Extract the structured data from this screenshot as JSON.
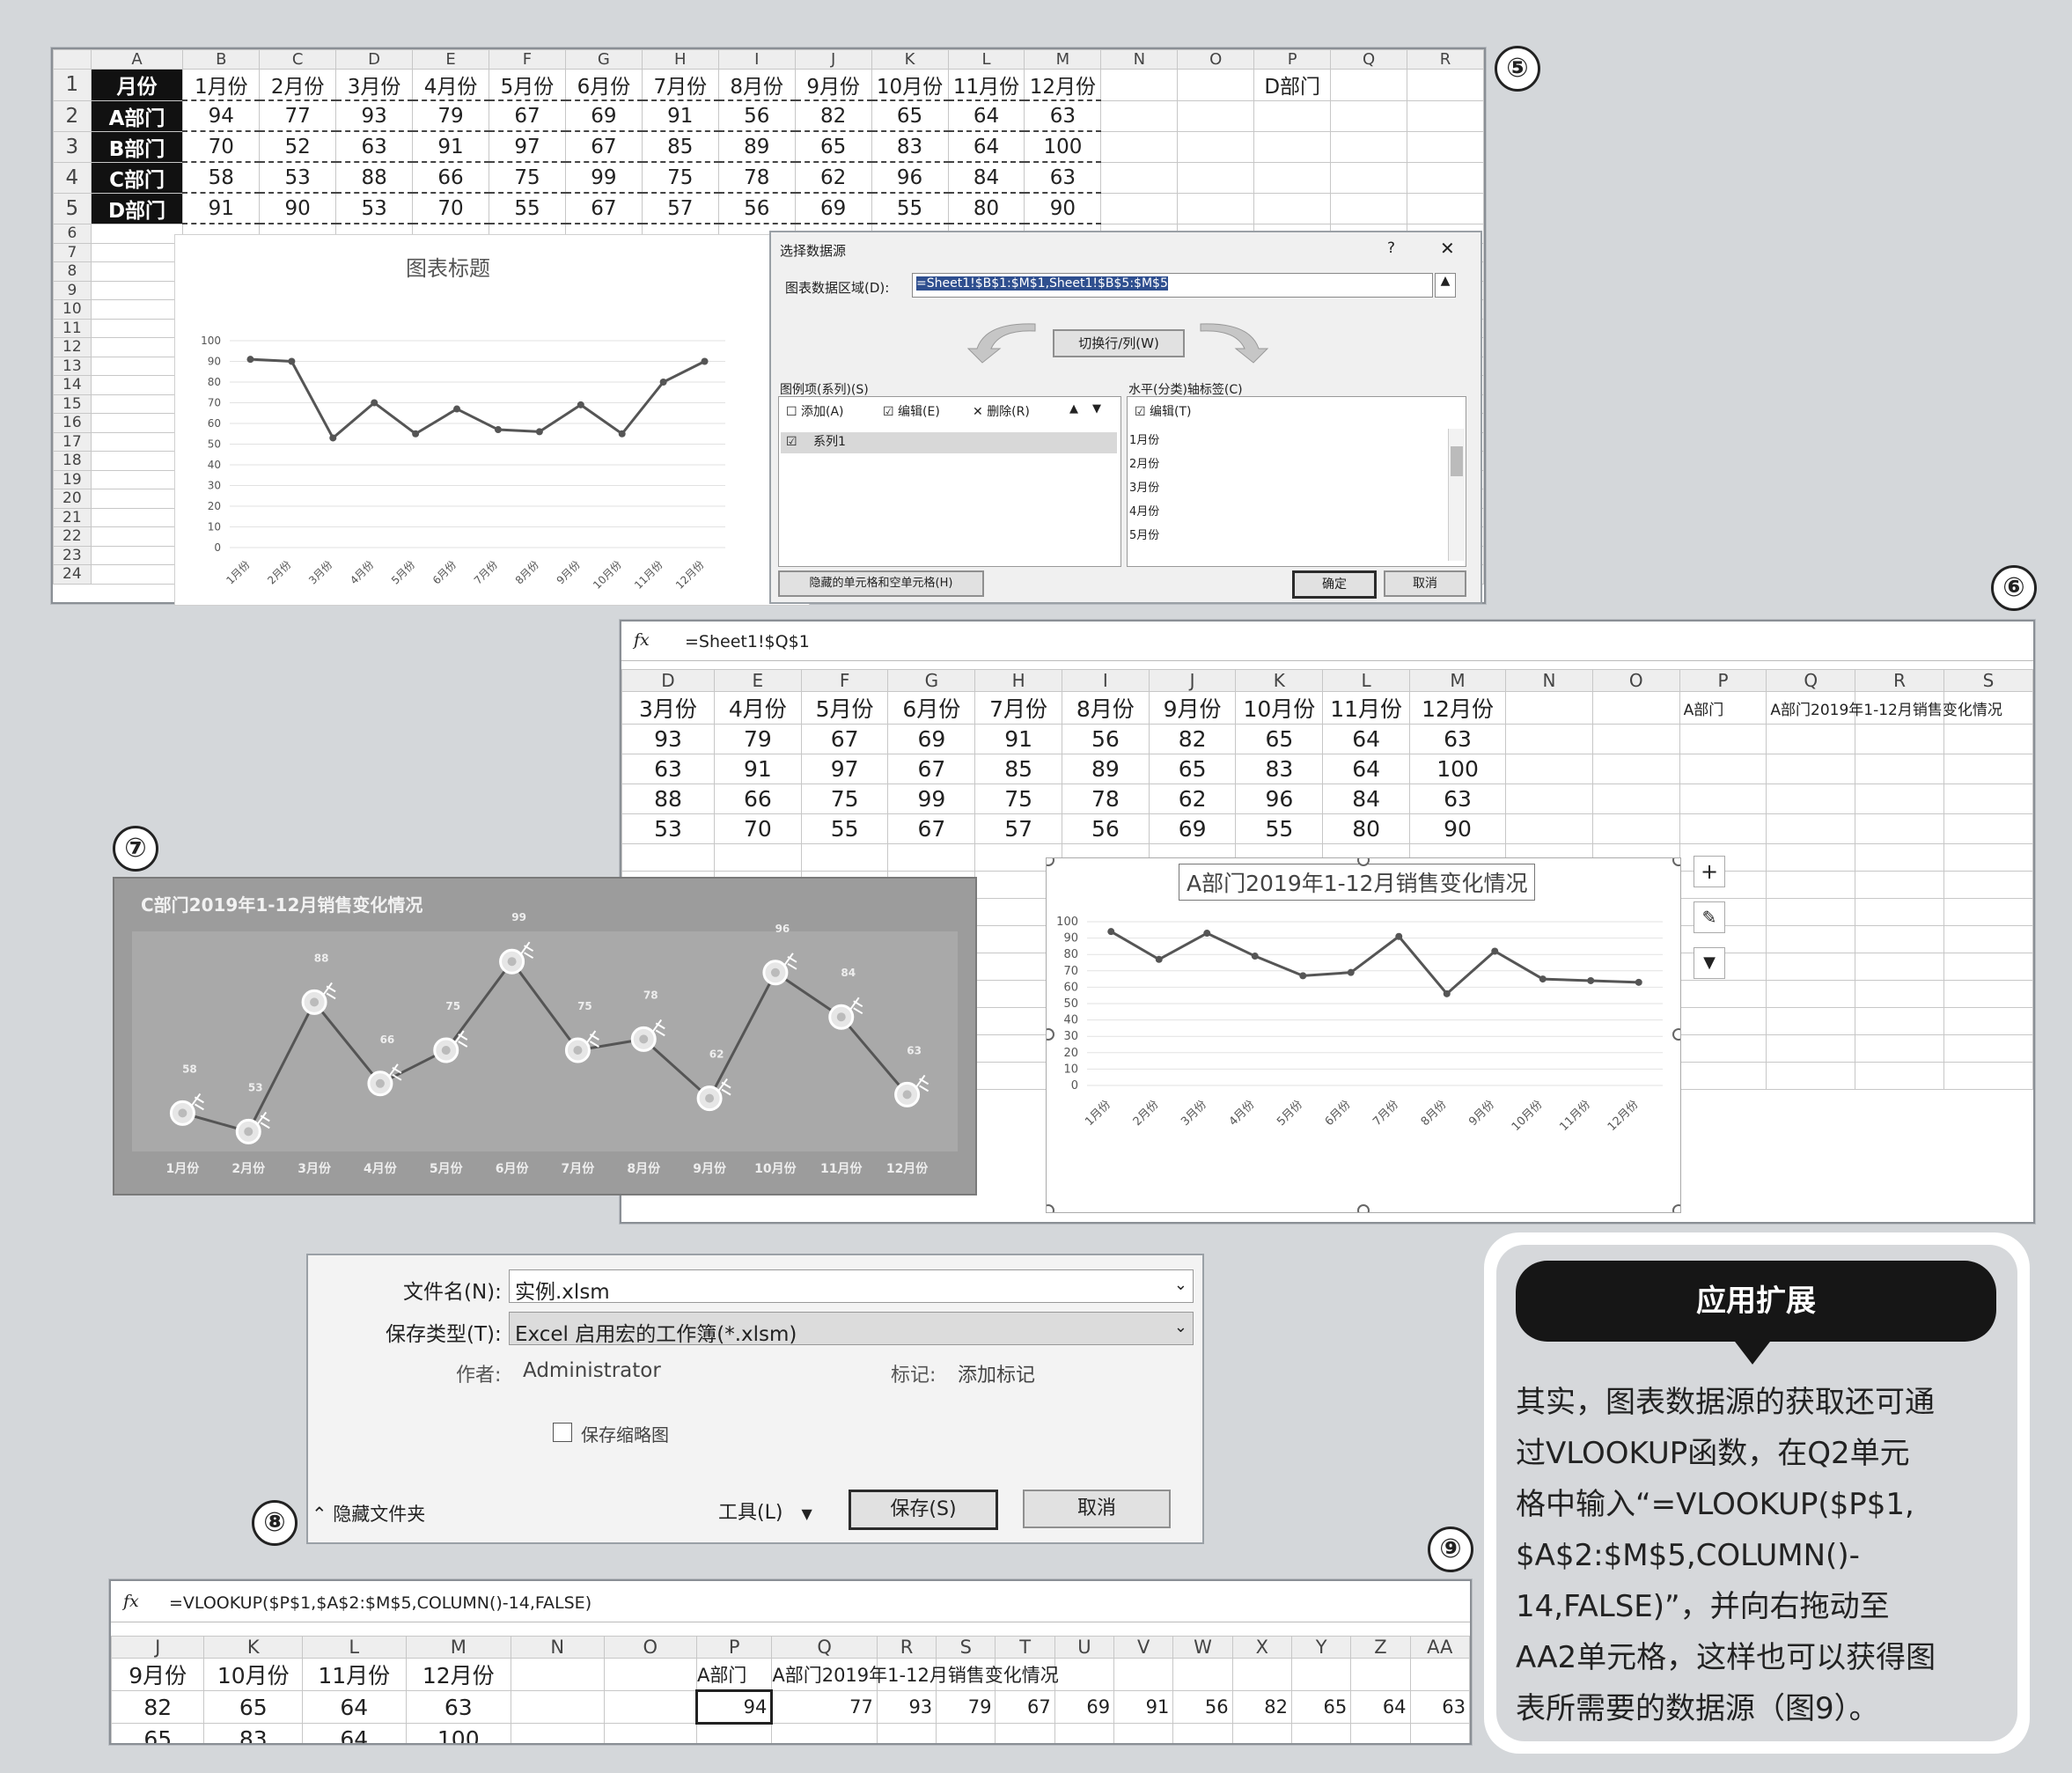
{
  "fig5": {
    "label": "⑤",
    "col_headers": [
      "",
      "A",
      "B",
      "C",
      "D",
      "E",
      "F",
      "G",
      "H",
      "I",
      "J",
      "K",
      "L",
      "M",
      "N",
      "O",
      "P",
      "Q",
      "R"
    ],
    "rows": [
      [
        "1",
        "月份",
        "1月份",
        "2月份",
        "3月份",
        "4月份",
        "5月份",
        "6月份",
        "7月份",
        "8月份",
        "9月份",
        "10月份",
        "11月份",
        "12月份",
        "",
        "",
        "D部门",
        "",
        ""
      ],
      [
        "2",
        "A部门",
        "94",
        "77",
        "93",
        "79",
        "67",
        "69",
        "91",
        "56",
        "82",
        "65",
        "64",
        "63",
        "",
        "",
        "",
        "",
        ""
      ],
      [
        "3",
        "B部门",
        "70",
        "52",
        "63",
        "91",
        "97",
        "67",
        "85",
        "89",
        "65",
        "83",
        "64",
        "100",
        "",
        "",
        "",
        "",
        ""
      ],
      [
        "4",
        "C部门",
        "58",
        "53",
        "88",
        "66",
        "75",
        "99",
        "75",
        "78",
        "62",
        "96",
        "84",
        "63",
        "",
        "",
        "",
        "",
        ""
      ],
      [
        "5",
        "D部门",
        "91",
        "90",
        "53",
        "70",
        "55",
        "67",
        "57",
        "56",
        "69",
        "55",
        "80",
        "90",
        "",
        "",
        "",
        "",
        ""
      ]
    ],
    "extra_rows": [
      "6",
      "7",
      "8",
      "9",
      "10",
      "11",
      "12",
      "13",
      "14",
      "15",
      "16",
      "17",
      "18",
      "19",
      "20",
      "21",
      "22",
      "23",
      "24"
    ],
    "chart_title": "图表标题",
    "dialog": {
      "title": "选择数据源",
      "help": "?",
      "close": "✕",
      "range_label": "图表数据区域(D):",
      "range_value": "=Sheet1!$B$1:$M$1,Sheet1!$B$5:$M$5",
      "switch_label": "切换行/列(W)",
      "legend_label": "图例项(系列)(S)",
      "add": "添加(A)",
      "edit": "编辑(E)",
      "delete": "删除(R)",
      "series_item": "系列1",
      "axis_label": "水平(分类)轴标签(C)",
      "axis_edit": "编辑(T)",
      "axis_items": [
        "1月份",
        "2月份",
        "3月份",
        "4月份",
        "5月份"
      ],
      "hidden_btn": "隐藏的单元格和空单元格(H)",
      "ok": "确定",
      "cancel": "取消"
    }
  },
  "fig6": {
    "label": "⑥",
    "fx": "fx",
    "formula": "=Sheet1!$Q$1",
    "col_headers": [
      "D",
      "E",
      "F",
      "G",
      "H",
      "I",
      "J",
      "K",
      "L",
      "M",
      "N",
      "O",
      "P",
      "Q",
      "R",
      "S"
    ],
    "rows": [
      [
        "3月份",
        "4月份",
        "5月份",
        "6月份",
        "7月份",
        "8月份",
        "9月份",
        "10月份",
        "11月份",
        "12月份",
        "",
        "",
        "A部门",
        "A部门2019年1-12月销售变化情况",
        "",
        ""
      ],
      [
        "93",
        "79",
        "67",
        "69",
        "91",
        "56",
        "82",
        "65",
        "64",
        "63",
        "",
        "",
        "",
        "",
        "",
        ""
      ],
      [
        "63",
        "91",
        "97",
        "67",
        "85",
        "89",
        "65",
        "83",
        "64",
        "100",
        "",
        "",
        "",
        "",
        "",
        ""
      ],
      [
        "88",
        "66",
        "75",
        "99",
        "75",
        "78",
        "62",
        "96",
        "84",
        "63",
        "",
        "",
        "",
        "",
        "",
        ""
      ],
      [
        "53",
        "70",
        "55",
        "67",
        "57",
        "56",
        "69",
        "55",
        "80",
        "90",
        "",
        "",
        "",
        "",
        "",
        ""
      ]
    ],
    "chart_title": "A部门2019年1-12月销售变化情况",
    "side_buttons": [
      "+",
      "✎",
      "▼"
    ]
  },
  "fig7": {
    "label": "⑦",
    "chart_title": "C部门2019年1-12月销售变化情况"
  },
  "fig8": {
    "label": "⑧",
    "filename_label": "文件名(N):",
    "filename_value": "实例.xlsm",
    "type_label": "保存类型(T):",
    "type_value": "Excel 启用宏的工作簿(*.xlsm)",
    "author_label": "作者:",
    "author_value": "Administrator",
    "tags_label": "标记:",
    "tags_value": "添加标记",
    "thumb_label": "保存缩略图",
    "hide_folders": "隐藏文件夹",
    "tools": "工具(L)",
    "save": "保存(S)",
    "cancel": "取消"
  },
  "fig9": {
    "label": "⑨",
    "fx": "fx",
    "formula": "=VLOOKUP($P$1,$A$2:$M$5,COLUMN()-14,FALSE)",
    "col_headers": [
      "J",
      "K",
      "L",
      "M",
      "N",
      "O",
      "P",
      "Q",
      "R",
      "S",
      "T",
      "U",
      "V",
      "W",
      "X",
      "Y",
      "Z",
      "AA"
    ],
    "rows": [
      [
        "9月份",
        "10月份",
        "11月份",
        "12月份",
        "",
        "",
        "A部门",
        "A部门2019年1-12月销售变化情况",
        "",
        "",
        "",
        "",
        "",
        "",
        "",
        "",
        "",
        ""
      ],
      [
        "82",
        "65",
        "64",
        "63",
        "",
        "",
        "94",
        "77",
        "93",
        "79",
        "67",
        "69",
        "91",
        "56",
        "82",
        "65",
        "64",
        "63"
      ],
      [
        "65",
        "83",
        "64",
        "100",
        "",
        "",
        "",
        "",
        "",
        "",
        "",
        "",
        "",
        "",
        "",
        "",
        "",
        ""
      ]
    ]
  },
  "sidebar": {
    "title": "应用扩展",
    "lines": [
      "其实，图表数据源的获取还可通",
      "过VLOOKUP函数，在Q2单元",
      "格中输入“=VLOOKUP($P$1,",
      "$A$2:$M$5,COLUMN()-",
      "14,FALSE)”，并向右拖动至",
      "AA2单元格，这样也可以获得图",
      "表所需要的数据源（图9）。"
    ]
  },
  "chart_data": [
    {
      "type": "line",
      "title": "图表标题",
      "categories": [
        "1月份",
        "2月份",
        "3月份",
        "4月份",
        "5月份",
        "6月份",
        "7月份",
        "8月份",
        "9月份",
        "10月份",
        "11月份",
        "12月份"
      ],
      "values": [
        91,
        90,
        53,
        70,
        55,
        67,
        57,
        56,
        69,
        55,
        80,
        90
      ],
      "ylim": [
        0,
        100
      ],
      "yticks": [
        "0",
        "10",
        "20",
        "30",
        "40",
        "50",
        "60",
        "70",
        "80",
        "90",
        "100"
      ],
      "grid": true
    },
    {
      "type": "line",
      "title": "A部门2019年1-12月销售变化情况",
      "categories": [
        "1月份",
        "2月份",
        "3月份",
        "4月份",
        "5月份",
        "6月份",
        "7月份",
        "8月份",
        "9月份",
        "10月份",
        "11月份",
        "12月份"
      ],
      "values": [
        94,
        77,
        93,
        79,
        67,
        69,
        91,
        56,
        82,
        65,
        64,
        63
      ],
      "ylim": [
        0,
        100
      ],
      "yticks": [
        "0",
        "10",
        "20",
        "30",
        "40",
        "50",
        "60",
        "70",
        "80",
        "90",
        "100"
      ],
      "grid": true
    },
    {
      "type": "line",
      "title": "C部门2019年1-12月销售变化情况",
      "categories": [
        "1月份",
        "2月份",
        "3月份",
        "4月份",
        "5月份",
        "6月份",
        "7月份",
        "8月份",
        "9月份",
        "10月份",
        "11月份",
        "12月份"
      ],
      "values": [
        58,
        53,
        88,
        66,
        75,
        99,
        75,
        78,
        62,
        96,
        84,
        63
      ],
      "data_labels": [
        "58",
        "53",
        "88",
        "66",
        "75",
        "99",
        "75",
        "78",
        "62",
        "96",
        "84",
        "63"
      ],
      "grid": false
    }
  ],
  "colors": {
    "background": "#d4d7da",
    "chart_line": "#555555",
    "sidebar_pill": "#161616"
  }
}
